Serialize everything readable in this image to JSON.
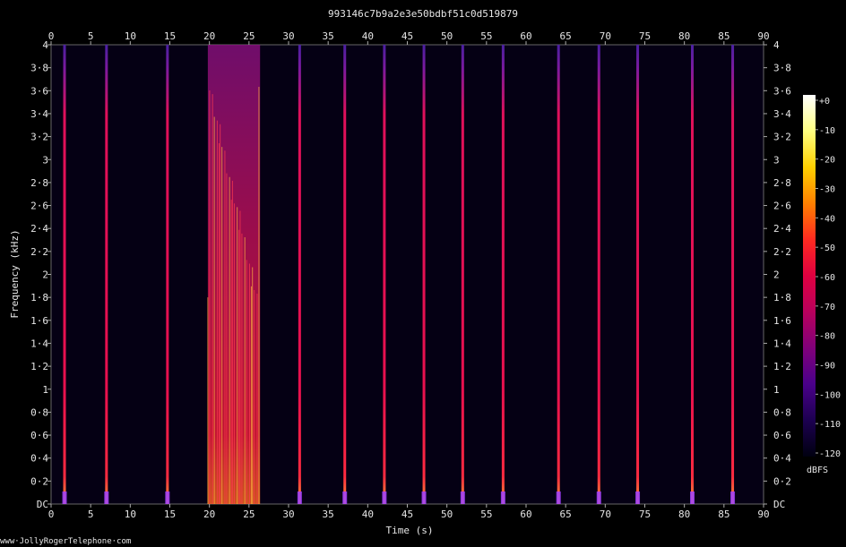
{
  "chart_data": {
    "type": "heatmap",
    "title": "993146c7b9a2e3e50bdbf51c0d519879",
    "xlabel": "Time (s)",
    "ylabel": "Frequency (kHz)",
    "xlim": [
      0,
      90
    ],
    "ylim": [
      0,
      4
    ],
    "x_ticks": [
      "0",
      "5",
      "10",
      "15",
      "20",
      "25",
      "30",
      "35",
      "40",
      "45",
      "50",
      "55",
      "60",
      "65",
      "70",
      "75",
      "80",
      "85",
      "90"
    ],
    "y_ticks": [
      "DC",
      "0·2",
      "0·4",
      "0·6",
      "0·8",
      "1",
      "1·2",
      "1·4",
      "1·6",
      "1·8",
      "2",
      "2·2",
      "2·4",
      "2·6",
      "2·8",
      "3",
      "3·2",
      "3·4",
      "3·6",
      "3·8",
      "4"
    ],
    "colorbar": {
      "label": "dBFS",
      "range": [
        -120,
        0
      ],
      "ticks": [
        "+0",
        "-10",
        "-20",
        "-30",
        "-40",
        "-50",
        "-60",
        "-70",
        "-80",
        "-90",
        "-100",
        "-110",
        "-120"
      ],
      "colors": [
        "#ffffff",
        "#ffff80",
        "#ffd000",
        "#ff8000",
        "#ff2a20",
        "#e00040",
        "#b8005c",
        "#80007a",
        "#4a008a",
        "#1c0050",
        "#000010"
      ]
    },
    "tone_bursts_s": [
      1.7,
      7.0,
      14.7,
      31.4,
      37.1,
      42.1,
      47.1,
      52.0,
      57.1,
      64.1,
      69.2,
      74.1,
      81.0,
      86.1
    ],
    "noise_segment_s": [
      19.8,
      26.4
    ],
    "footer": "www·JollyRogerTelephone·com"
  }
}
